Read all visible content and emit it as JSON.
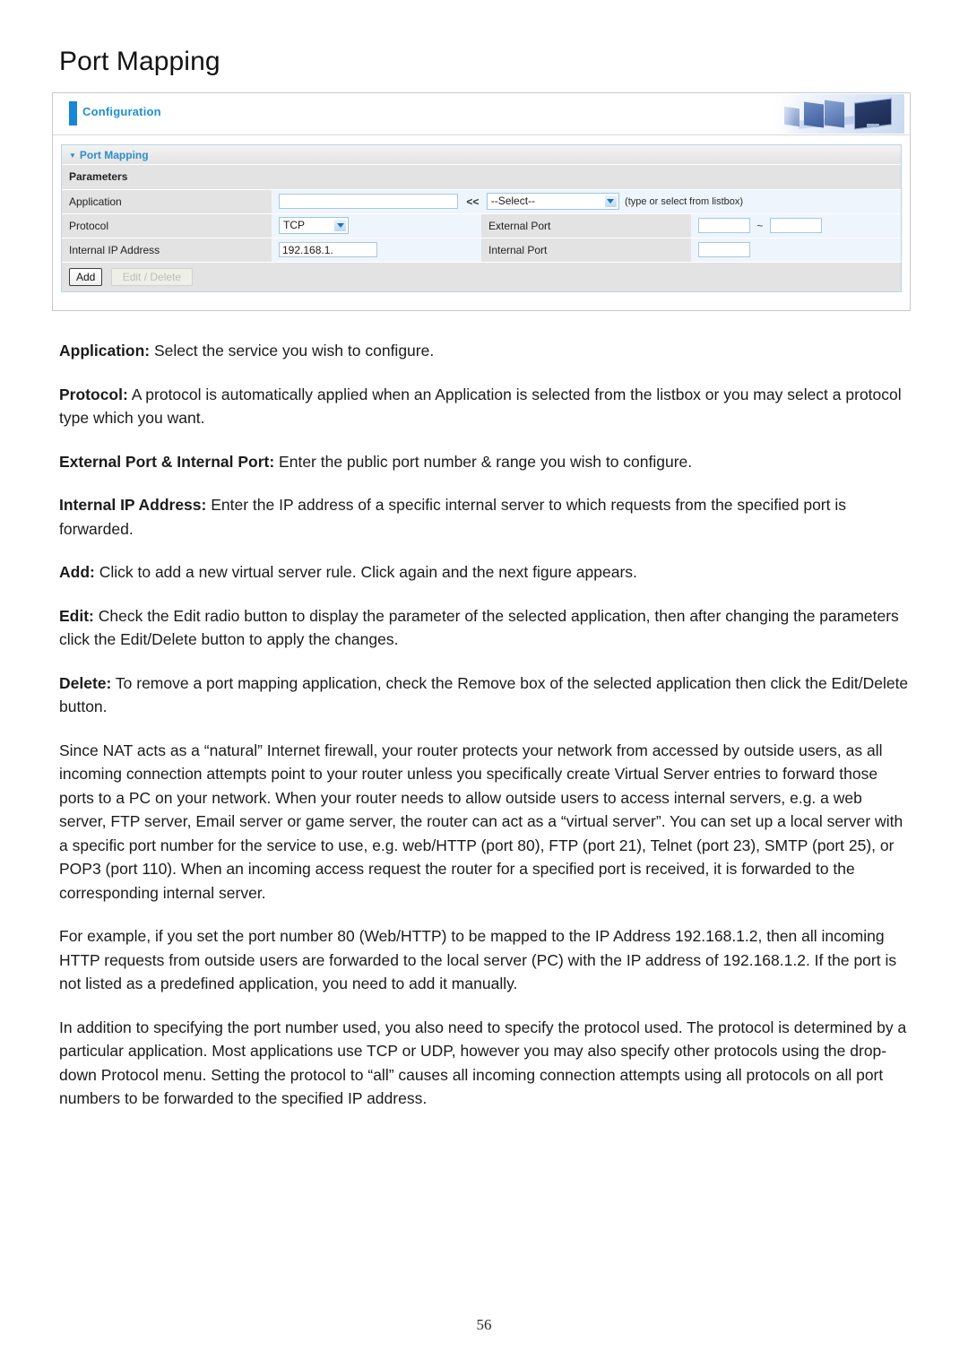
{
  "page": {
    "title": "Port Mapping",
    "number": "56"
  },
  "screenshot": {
    "header": {
      "title": "Configuration",
      "image_alt": "office-workstation-banner"
    },
    "panel": {
      "title": "Port Mapping",
      "collapse_marker": "▼",
      "parameters_header": "Parameters",
      "rows": {
        "application": {
          "label": "Application",
          "input_value": "",
          "arrow_label": "<<",
          "select_value": "--Select--",
          "hint": "(type or select from listbox)"
        },
        "protocol": {
          "label": "Protocol",
          "select_value": "TCP"
        },
        "external_port": {
          "label": "External Port",
          "from_value": "",
          "separator": "~",
          "to_value": ""
        },
        "internal_ip": {
          "label": "Internal IP Address",
          "input_value": "192.168.1."
        },
        "internal_port": {
          "label": "Internal Port",
          "input_value": ""
        }
      },
      "buttons": {
        "add": "Add",
        "edit_delete": "Edit / Delete"
      }
    }
  },
  "body": {
    "paragraphs": [
      {
        "lead": "Application:",
        "text": " Select the service you wish to configure."
      },
      {
        "lead": "Protocol:",
        "text": " A protocol is automatically applied when an Application is selected from the listbox or you may select a protocol type which you want."
      },
      {
        "lead": "External Port & Internal Port:",
        "text": " Enter the public port number & range you wish to configure."
      },
      {
        "lead": "Internal IP Address:",
        "text": " Enter the IP address of a specific internal server to which requests from the specified port is forwarded."
      },
      {
        "lead": "Add:",
        "text": " Click to add a new virtual server rule. Click again and the next figure appears."
      },
      {
        "lead": "Edit:",
        "text": " Check the Edit radio button to display the parameter of the selected application, then after changing the parameters click the Edit/Delete button to apply the changes."
      },
      {
        "lead": "Delete:",
        "text": " To remove a port mapping application, check the Remove box of the selected application then click the Edit/Delete button."
      },
      {
        "lead": "",
        "text": "Since NAT acts as a “natural” Internet firewall, your router protects your network from accessed by outside users, as all incoming connection attempts point to your router unless you specifically create Virtual Server entries to forward those ports to a PC on your network. When your router needs to allow outside users to access internal servers, e.g. a web server, FTP server, Email server or game server, the router can act as a “virtual server”. You can set up a local server with a specific port number for the service to use, e.g. web/HTTP (port 80), FTP (port 21), Telnet (port 23), SMTP (port 25), or POP3 (port 110). When an incoming access request the router for a specified port is received, it is forwarded to the corresponding internal server."
      },
      {
        "lead": "",
        "text": "For example, if you set the port number 80 (Web/HTTP) to be mapped to the IP Address 192.168.1.2, then all incoming HTTP requests from outside users are forwarded to the local server (PC) with the IP address of 192.168.1.2. If the port is not listed as a predefined application, you need to add it manually."
      },
      {
        "lead": "",
        "text": "In addition to specifying the port number used, you also need to specify the protocol used. The protocol is determined by a particular application. Most applications use TCP or UDP, however you may also specify other protocols using the drop-down Protocol menu. Setting the protocol to “all” causes all incoming connection attempts using all protocols on all port numbers to be forwarded to the specified IP address."
      }
    ]
  },
  "colors": {
    "accent_blue": "#1f8fd8",
    "bar_blue": "#1686d6",
    "label_gray": "#e3e3e3",
    "field_blue": "#eff5fd",
    "panel_border": "#b9d6e0"
  }
}
